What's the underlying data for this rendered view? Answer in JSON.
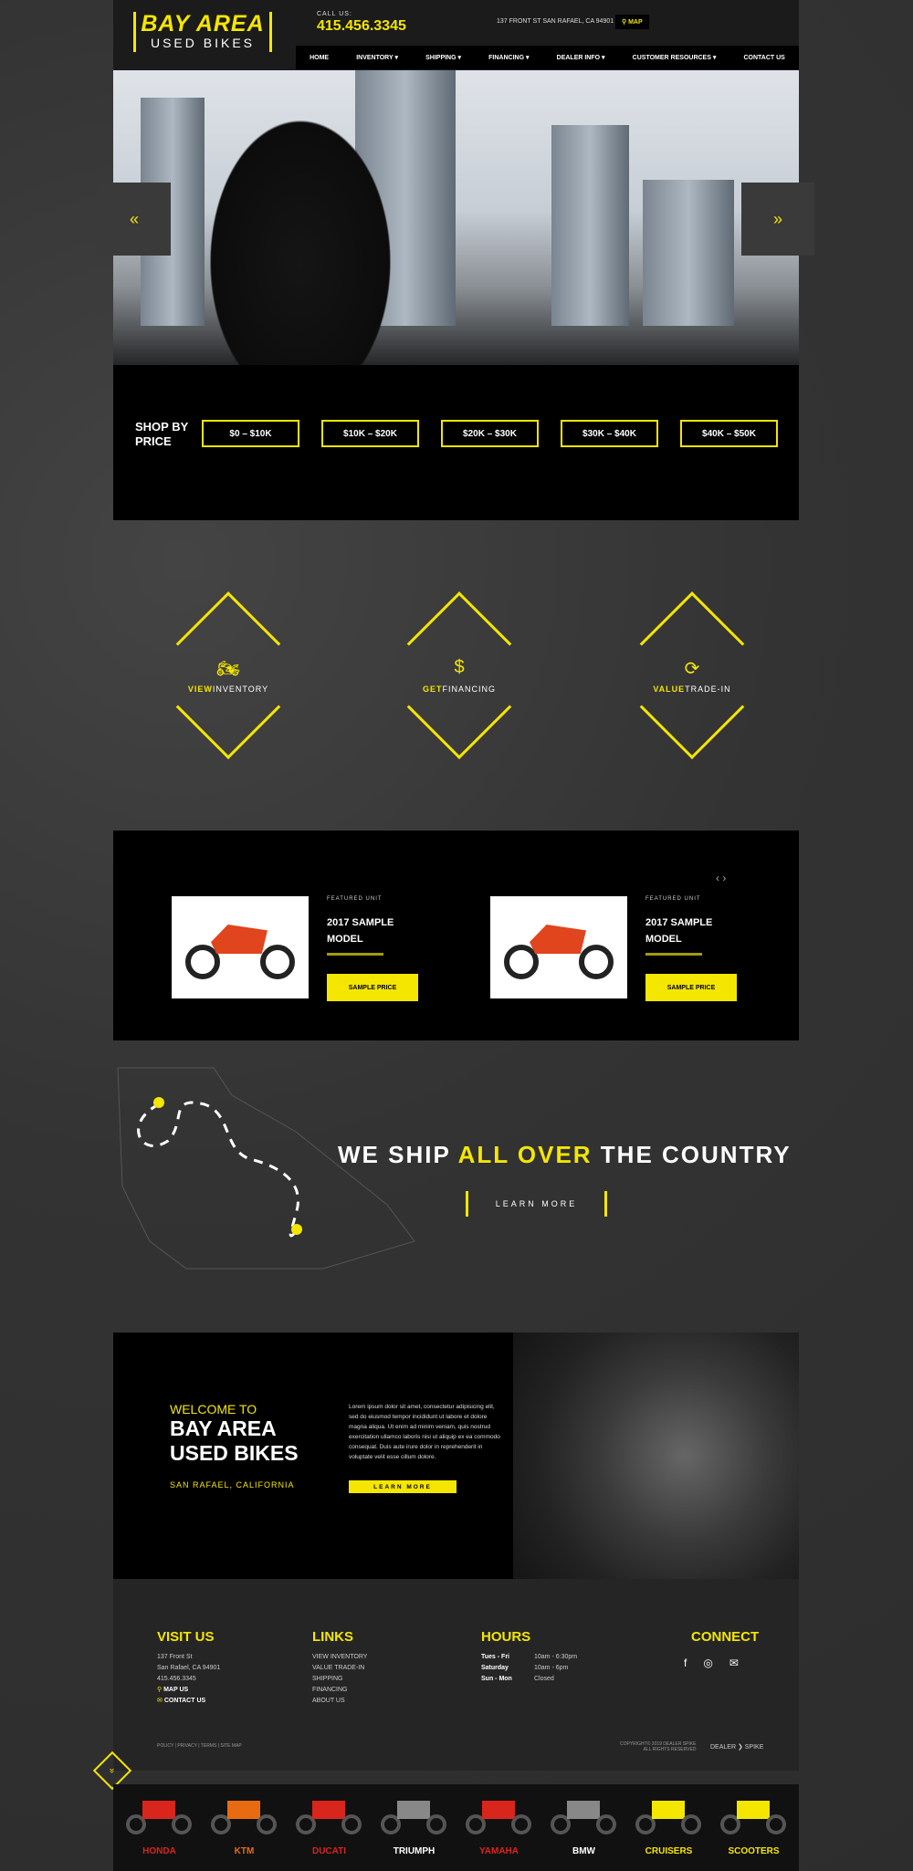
{
  "header": {
    "logo_line1": "BAY AREA",
    "logo_line2": "USED BIKES",
    "call_label": "CALL US:",
    "phone": "415.456.3345",
    "address": "137 FRONT ST SAN RAFAEL, CA 94901",
    "map_label": "MAP",
    "nav": [
      "HOME",
      "INVENTORY ▾",
      "SHIPPING ▾",
      "FINANCING ▾",
      "DEALER INFO ▾",
      "CUSTOMER RESOURCES ▾",
      "CONTACT US"
    ]
  },
  "hero": {
    "prev": "«",
    "next": "»"
  },
  "shop": {
    "label_line1": "SHOP BY",
    "label_line2": "PRICE",
    "prices": [
      "$0 – $10K",
      "$10K – $20K",
      "$20K – $30K",
      "$30K – $40K",
      "$40K – $50K"
    ]
  },
  "actions": [
    {
      "icon": "🏍",
      "bold": "VIEW",
      "rest": "INVENTORY"
    },
    {
      "icon": "$",
      "bold": "GET",
      "rest": "FINANCING"
    },
    {
      "icon": "⟳",
      "bold": "VALUE",
      "rest": "TRADE-IN"
    }
  ],
  "featured": {
    "nav": "‹ ›",
    "units": [
      {
        "kicker": "FEATURED UNIT",
        "title_line1": "2017 SAMPLE",
        "title_line2": "MODEL",
        "price": "SAMPLE PRICE"
      },
      {
        "kicker": "FEATURED UNIT",
        "title_line1": "2017 SAMPLE",
        "title_line2": "MODEL",
        "price": "SAMPLE PRICE"
      }
    ]
  },
  "shipping": {
    "title_a": "WE SHIP ",
    "title_b": "ALL OVER",
    "title_c": " THE COUNTRY",
    "button": "LEARN MORE"
  },
  "welcome": {
    "kicker": "WELCOME TO",
    "title_line1": "BAY AREA",
    "title_line2": "USED BIKES",
    "location": "SAN RAFAEL, CALIFORNIA",
    "body": "Lorem ipsum dolor sit amet, consectetur adipisicing elit, sed do eiusmod tempor incididunt ut labore et dolore magna aliqua. Ut enim ad minim veniam, quis nostrud exercitation ullamco laboris nisi ut aliquip ex ea commodo consequat. Duis aute irure dolor in reprehenderit in voluptate velit esse cillum dolore.",
    "button": "LEARN MORE"
  },
  "footer": {
    "visit_head": "VISIT US",
    "visit": [
      "137 Front St",
      "San Rafael, CA 94901",
      "415.456.3345"
    ],
    "map_us": "MAP US",
    "contact_us": "CONTACT US",
    "links_head": "LINKS",
    "links": [
      "VIEW INVENTORY",
      "VALUE TRADE-IN",
      "SHIPPING",
      "FINANCING",
      "ABOUT US"
    ],
    "hours_head": "HOURS",
    "hours": [
      {
        "day": "Tues - Fri",
        "time": "10am - 6:30pm"
      },
      {
        "day": "Saturday",
        "time": "10am - 6pm"
      },
      {
        "day": "Sun - Mon",
        "time": "Closed"
      }
    ],
    "connect_head": "CONNECT",
    "social": [
      "f",
      "◎",
      "✉"
    ],
    "legal": "POLICY | PRIVACY | TERMS | SITE MAP",
    "copy_line1": "COPYRIGHT© 2019 DEALER SPIKE",
    "copy_line2": "ALL RIGHTS RESERVED",
    "dealer": "DEALER ❯ SPIKE",
    "scroll_top": "»"
  },
  "brands": [
    {
      "name": "HONDA",
      "color": "#d8261c"
    },
    {
      "name": "KTM",
      "color": "#e86b12"
    },
    {
      "name": "DUCATI",
      "color": "#d8261c"
    },
    {
      "name": "TRIUMPH",
      "color": "#ffffff"
    },
    {
      "name": "YAMAHA",
      "color": "#d8261c"
    },
    {
      "name": "BMW",
      "color": "#ffffff"
    },
    {
      "name": "CRUISERS",
      "color": "#f5e600"
    },
    {
      "name": "SCOOTERS",
      "color": "#f5e600"
    }
  ]
}
